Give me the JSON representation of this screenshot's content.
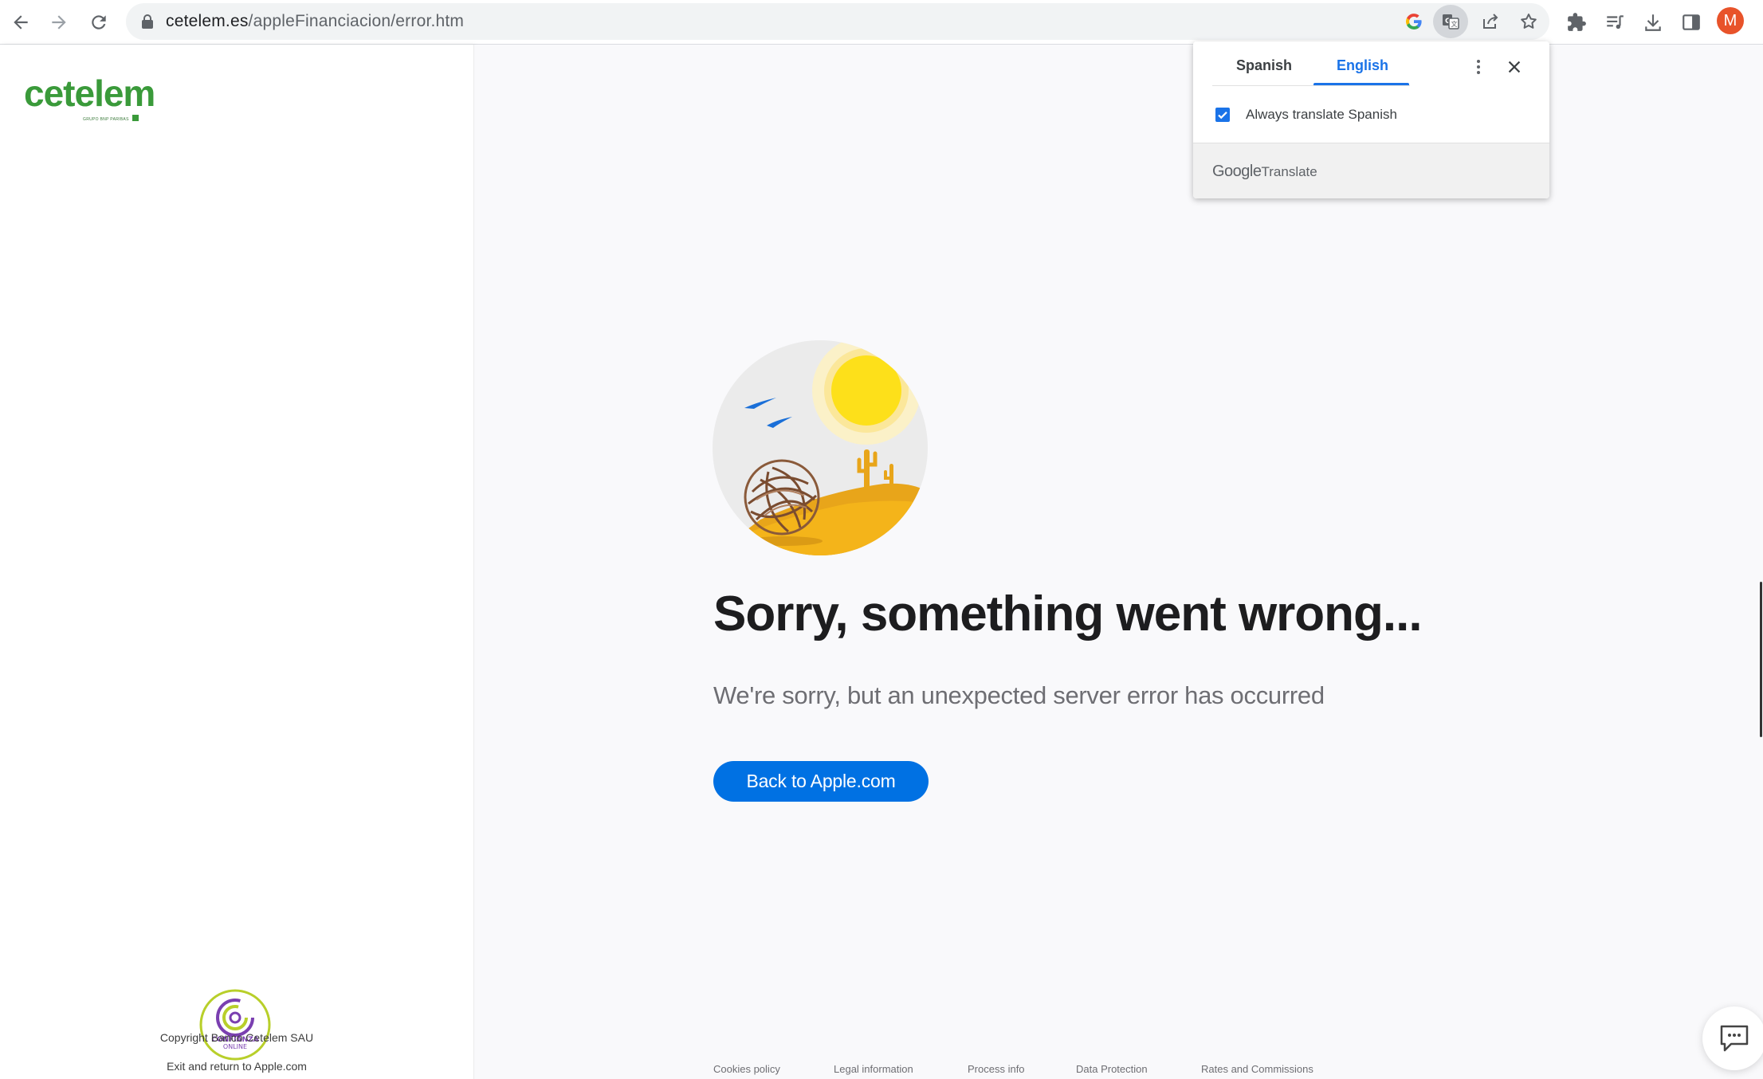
{
  "browser": {
    "url_domain": "cetelem.es",
    "url_path": "/appleFinanciacion/error.htm",
    "avatar_initial": "M",
    "icons": {
      "back": "arrow-back-icon",
      "forward": "arrow-forward-icon",
      "reload": "reload-icon",
      "lock": "lock-icon",
      "google": "google-g-icon",
      "translate": "translate-icon",
      "share": "share-icon",
      "bookmark": "star-icon",
      "extensions": "puzzle-icon",
      "media": "media-playlist-icon",
      "download": "download-icon",
      "side_panel": "side-panel-icon"
    }
  },
  "translate_popup": {
    "tabs": [
      "Spanish",
      "English"
    ],
    "active_tab": "English",
    "always_translate_label": "Always translate Spanish",
    "always_translate_checked": true,
    "brand_google": "Google",
    "brand_translate": "Translate"
  },
  "sidebar": {
    "logo_text": "cetelem",
    "logo_subtext": "GRUPO BNP PARIBAS",
    "seal_text_1": "CONFIANZA",
    "seal_text_2": "ONLINE",
    "copyright": "Copyright Banco Cetelem SAU",
    "exit_link": "Exit and return to Apple.com"
  },
  "main": {
    "headline": "Sorry, something went wrong...",
    "subheadline": "We're sorry, but an unexpected server error has occurred",
    "cta_label": "Back to Apple.com",
    "footer_links": [
      "Cookies policy",
      "Legal information",
      "Process info",
      "Data Protection",
      "Rates and Commissions"
    ]
  },
  "colors": {
    "cetelem_green": "#3a9a3a",
    "apple_blue": "#0071e3",
    "chrome_blue": "#1a73e8",
    "avatar_orange": "#e8532a"
  }
}
